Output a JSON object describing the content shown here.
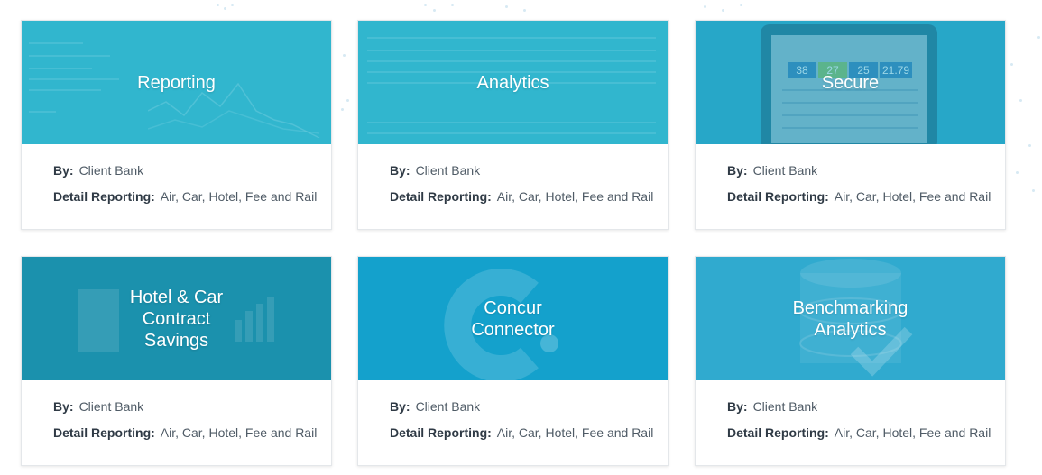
{
  "cards": [
    {
      "title": "Reporting",
      "by_label": "By:",
      "by_value": "Client Bank",
      "detail_label": "Detail Reporting:",
      "detail_value": "Air, Car, Hotel, Fee and Rail",
      "color": "#3cb8cf"
    },
    {
      "title": "Analytics",
      "by_label": "By:",
      "by_value": "Client Bank",
      "detail_label": "Detail Reporting:",
      "detail_value": "Air, Car, Hotel, Fee and Rail",
      "color": "#3cb8cf"
    },
    {
      "title": "Secure",
      "by_label": "By:",
      "by_value": "Client Bank",
      "detail_label": "Detail Reporting:",
      "detail_value": "Air, Car, Hotel, Fee and Rail",
      "color": "#2ea9c9"
    },
    {
      "title": "Hotel & Car\nContract\nSavings",
      "by_label": "By:",
      "by_value": "Client Bank",
      "detail_label": "Detail Reporting:",
      "detail_value": "Air, Car, Hotel, Fee and Rail",
      "color": "#1f94b0"
    },
    {
      "title": "Concur\nConnector",
      "by_label": "By:",
      "by_value": "Client Bank",
      "detail_label": "Detail Reporting:",
      "detail_value": "Air, Car, Hotel, Fee and Rail",
      "color": "#14a2cc"
    },
    {
      "title": "Benchmarking\nAnalytics",
      "by_label": "By:",
      "by_value": "Client Bank",
      "detail_label": "Detail Reporting:",
      "detail_value": "Air, Car, Hotel, Fee and Rail",
      "color": "#33acd0"
    }
  ],
  "tablet_stats": [
    "38",
    "27",
    "25",
    "21.79"
  ]
}
